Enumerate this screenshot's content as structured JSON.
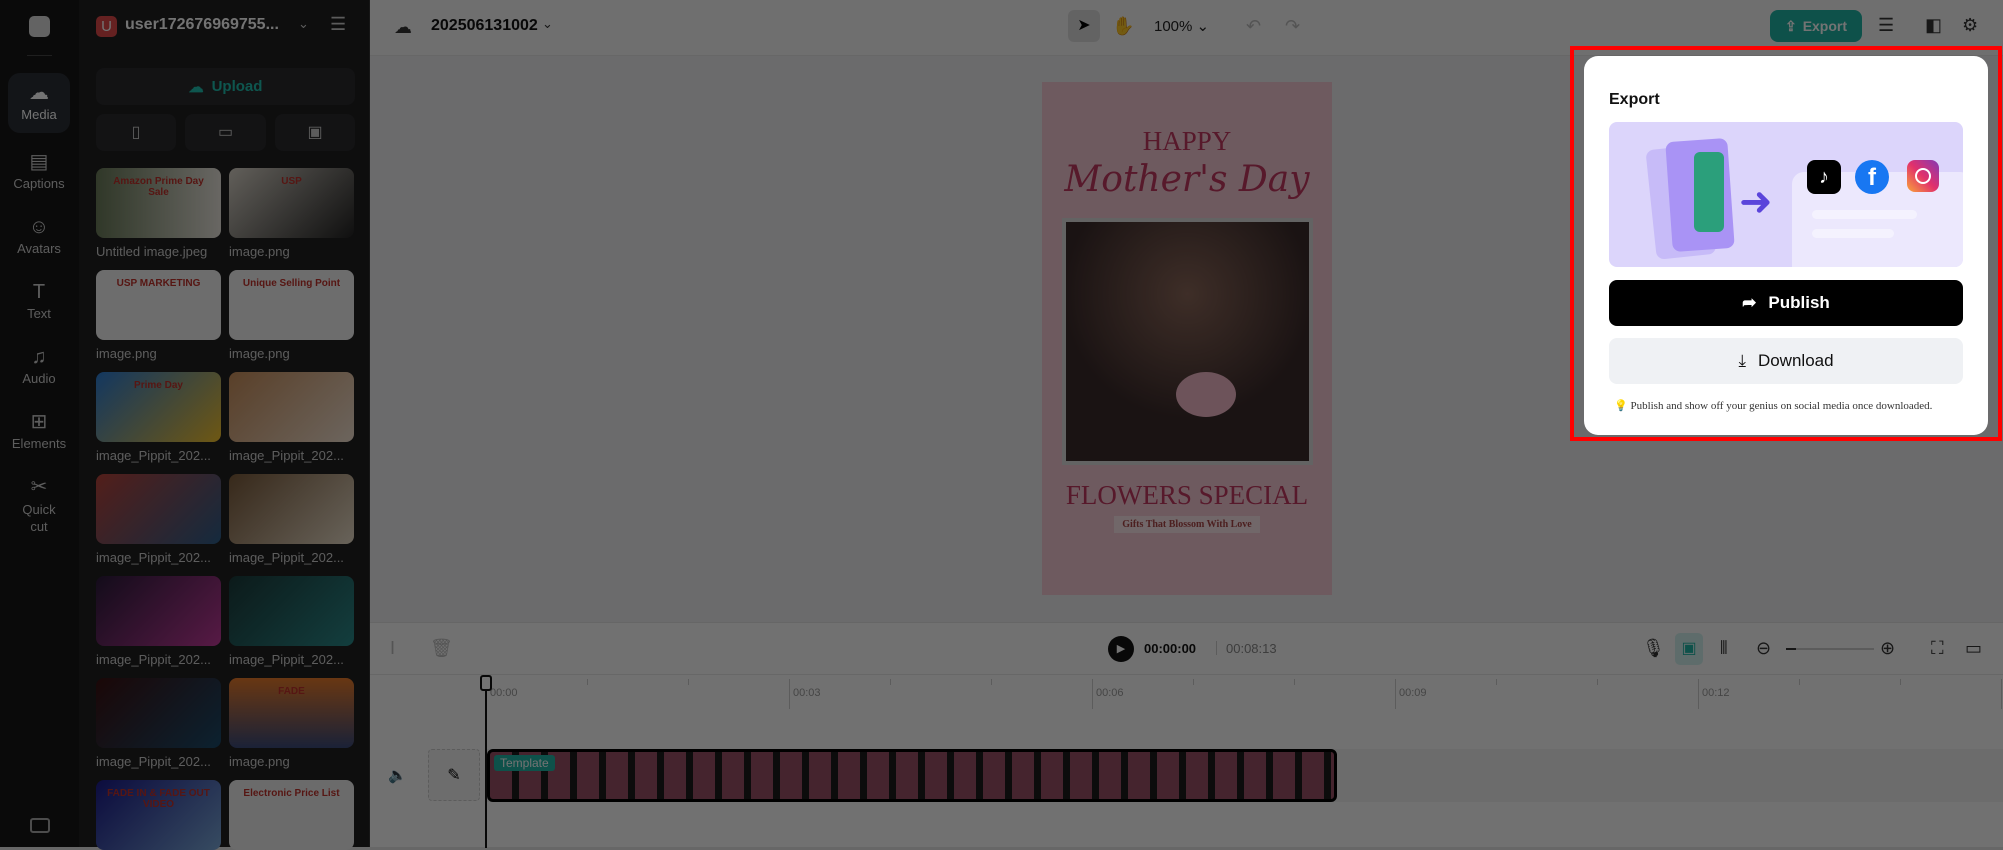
{
  "rail": {
    "items": [
      {
        "label": "Media",
        "icon": "cloud-upload-icon"
      },
      {
        "label": "Captions",
        "icon": "captions-icon"
      },
      {
        "label": "Avatars",
        "icon": "avatar-icon"
      },
      {
        "label": "Text",
        "icon": "text-icon"
      },
      {
        "label": "Audio",
        "icon": "music-icon"
      },
      {
        "label": "Elements",
        "icon": "elements-icon"
      },
      {
        "label": "Quick cut",
        "icon": "scissors-icon"
      }
    ]
  },
  "panel": {
    "user_initial": "U",
    "username": "user172676969755...",
    "upload_label": "Upload",
    "media": [
      {
        "name": "Untitled image.jpeg",
        "thumb_text": "Amazon Prime Day Sale"
      },
      {
        "name": "image.png",
        "thumb_text": "USP"
      },
      {
        "name": "image.png",
        "thumb_text": "USP MARKETING"
      },
      {
        "name": "image.png",
        "thumb_text": "Unique Selling Point"
      },
      {
        "name": "image_Pippit_202...",
        "thumb_text": "Prime Day"
      },
      {
        "name": "image_Pippit_202...",
        "thumb_text": ""
      },
      {
        "name": "image_Pippit_202...",
        "thumb_text": ""
      },
      {
        "name": "image_Pippit_202...",
        "thumb_text": ""
      },
      {
        "name": "image_Pippit_202...",
        "thumb_text": ""
      },
      {
        "name": "image_Pippit_202...",
        "thumb_text": ""
      },
      {
        "name": "image_Pippit_202...",
        "thumb_text": ""
      },
      {
        "name": "image.png",
        "thumb_text": "FADE"
      },
      {
        "name": "",
        "thumb_text": "FADE IN & FADE OUT VIDEO"
      },
      {
        "name": "",
        "thumb_text": "Electronic Price List"
      }
    ]
  },
  "topbar": {
    "project_name": "202506131002",
    "zoom": "100%",
    "export_label": "Export"
  },
  "canvas": {
    "line1": "HAPPY",
    "line2": "Mother's Day",
    "line3": "FLOWERS SPECIAL",
    "line4": "Gifts That Blossom With Love"
  },
  "timeline": {
    "current_time": "00:00:00",
    "total_time": "00:08:13",
    "ticks": [
      "00:00",
      "00:03",
      "00:06",
      "00:09",
      "00:12"
    ],
    "clip_label": "Template"
  },
  "export_popup": {
    "title": "Export",
    "publish_label": "Publish",
    "download_label": "Download",
    "tip": "Publish and show off your genius on social media once downloaded."
  },
  "colors": {
    "accent": "#1fb3a4",
    "overlay": "#000000",
    "highlight": "#ff0000"
  }
}
